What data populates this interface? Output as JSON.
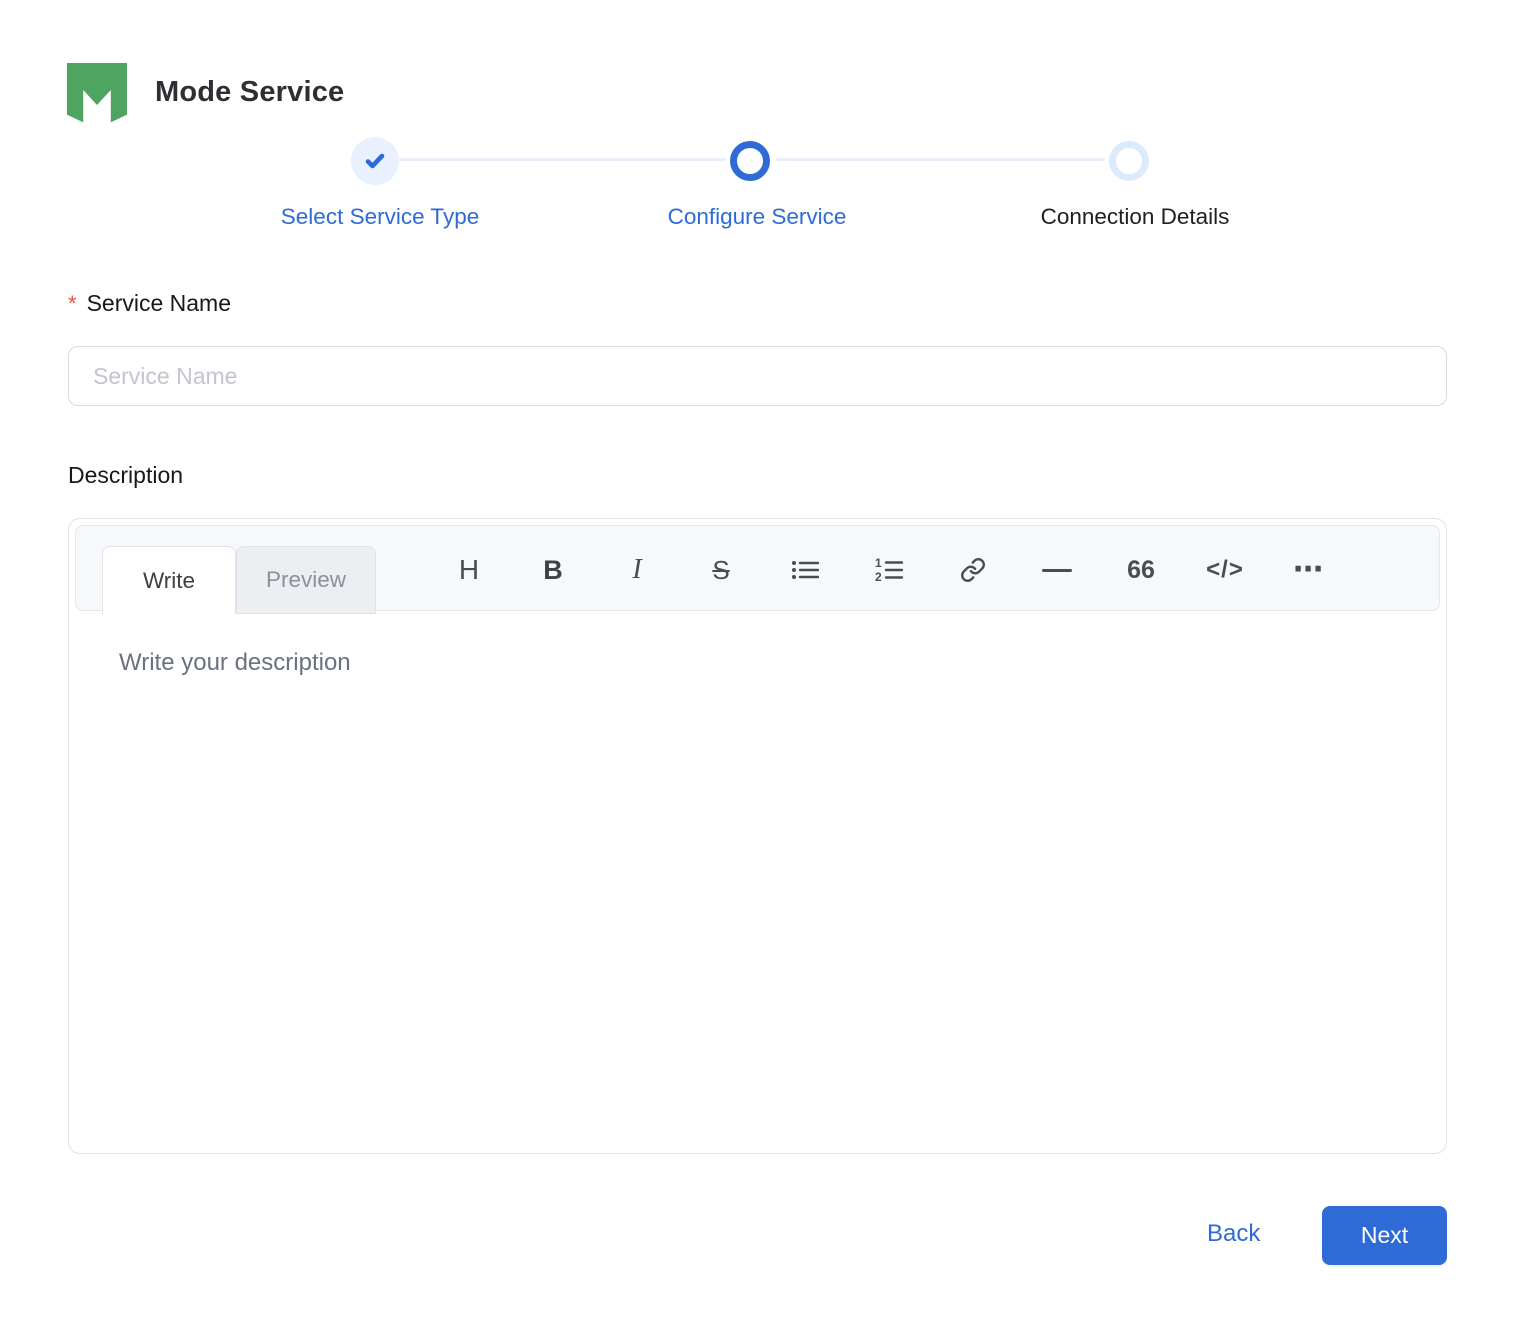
{
  "header": {
    "title": "Mode Service"
  },
  "stepper": {
    "steps": [
      {
        "label": "Select Service Type",
        "state": "completed"
      },
      {
        "label": "Configure Service",
        "state": "active"
      },
      {
        "label": "Connection Details",
        "state": "pending"
      }
    ]
  },
  "form": {
    "service_name": {
      "label": "Service Name",
      "required_mark": "*",
      "value": "",
      "placeholder": "Service Name"
    },
    "description": {
      "label": "Description",
      "value": "",
      "placeholder": "Write your description"
    }
  },
  "editor": {
    "tabs": [
      {
        "label": "Write",
        "active": true
      },
      {
        "label": "Preview",
        "active": false
      }
    ],
    "toolbar": [
      {
        "name": "heading-icon",
        "glyph": "H"
      },
      {
        "name": "bold-icon",
        "glyph": "B"
      },
      {
        "name": "italic-icon",
        "glyph": "I"
      },
      {
        "name": "strikethrough-icon",
        "glyph": "S"
      },
      {
        "name": "bulleted-list-icon"
      },
      {
        "name": "numbered-list-icon"
      },
      {
        "name": "link-icon"
      },
      {
        "name": "horizontal-rule-icon"
      },
      {
        "name": "quote-icon",
        "glyph": "66"
      },
      {
        "name": "code-icon",
        "glyph": "</>"
      },
      {
        "name": "more-options-icon",
        "glyph": "⋯"
      }
    ]
  },
  "footer": {
    "back_label": "Back",
    "next_label": "Next"
  },
  "colors": {
    "primary_blue": "#2e6bd6",
    "logo_green": "#4fa462",
    "required_red": "#e8554f",
    "step_track": "#e9eff8",
    "pending_ring": "#dcebfc"
  }
}
